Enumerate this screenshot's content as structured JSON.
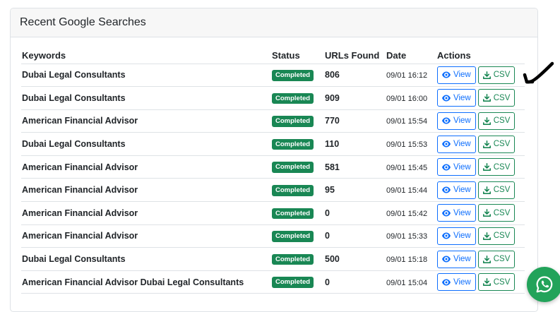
{
  "card": {
    "title": "Recent Google Searches"
  },
  "table": {
    "headers": {
      "keywords": "Keywords",
      "status": "Status",
      "urls": "URLs Found",
      "date": "Date",
      "actions": "Actions"
    },
    "rows": [
      {
        "keyword": "Dubai Legal Consultants",
        "status": "Completed",
        "urls": "806",
        "date": "09/01 16:12",
        "view": "View",
        "csv": "CSV"
      },
      {
        "keyword": "Dubai Legal Consultants",
        "status": "Completed",
        "urls": "909",
        "date": "09/01 16:00",
        "view": "View",
        "csv": "CSV"
      },
      {
        "keyword": "American Financial Advisor",
        "status": "Completed",
        "urls": "770",
        "date": "09/01 15:54",
        "view": "View",
        "csv": "CSV"
      },
      {
        "keyword": "Dubai Legal Consultants",
        "status": "Completed",
        "urls": "110",
        "date": "09/01 15:53",
        "view": "View",
        "csv": "CSV"
      },
      {
        "keyword": "American Financial Advisor",
        "status": "Completed",
        "urls": "581",
        "date": "09/01 15:45",
        "view": "View",
        "csv": "CSV"
      },
      {
        "keyword": "American Financial Advisor",
        "status": "Completed",
        "urls": "95",
        "date": "09/01 15:44",
        "view": "View",
        "csv": "CSV"
      },
      {
        "keyword": "American Financial Advisor",
        "status": "Completed",
        "urls": "0",
        "date": "09/01 15:42",
        "view": "View",
        "csv": "CSV"
      },
      {
        "keyword": "American Financial Advisor",
        "status": "Completed",
        "urls": "0",
        "date": "09/01 15:33",
        "view": "View",
        "csv": "CSV"
      },
      {
        "keyword": "Dubai Legal Consultants",
        "status": "Completed",
        "urls": "500",
        "date": "09/01 15:18",
        "view": "View",
        "csv": "CSV"
      },
      {
        "keyword": "American Financial Advisor Dubai Legal Consultants",
        "status": "Completed",
        "urls": "0",
        "date": "09/01 15:04",
        "view": "View",
        "csv": "CSV"
      }
    ]
  },
  "icons": {
    "view": "eye-icon",
    "csv": "download-icon",
    "fab": "whatsapp-icon",
    "annotation": "hand-drawn-arrow"
  },
  "colors": {
    "primary": "#0d6efd",
    "success": "#198754",
    "whatsapp": "#22a35a",
    "header_bg": "#f7f7f7"
  }
}
